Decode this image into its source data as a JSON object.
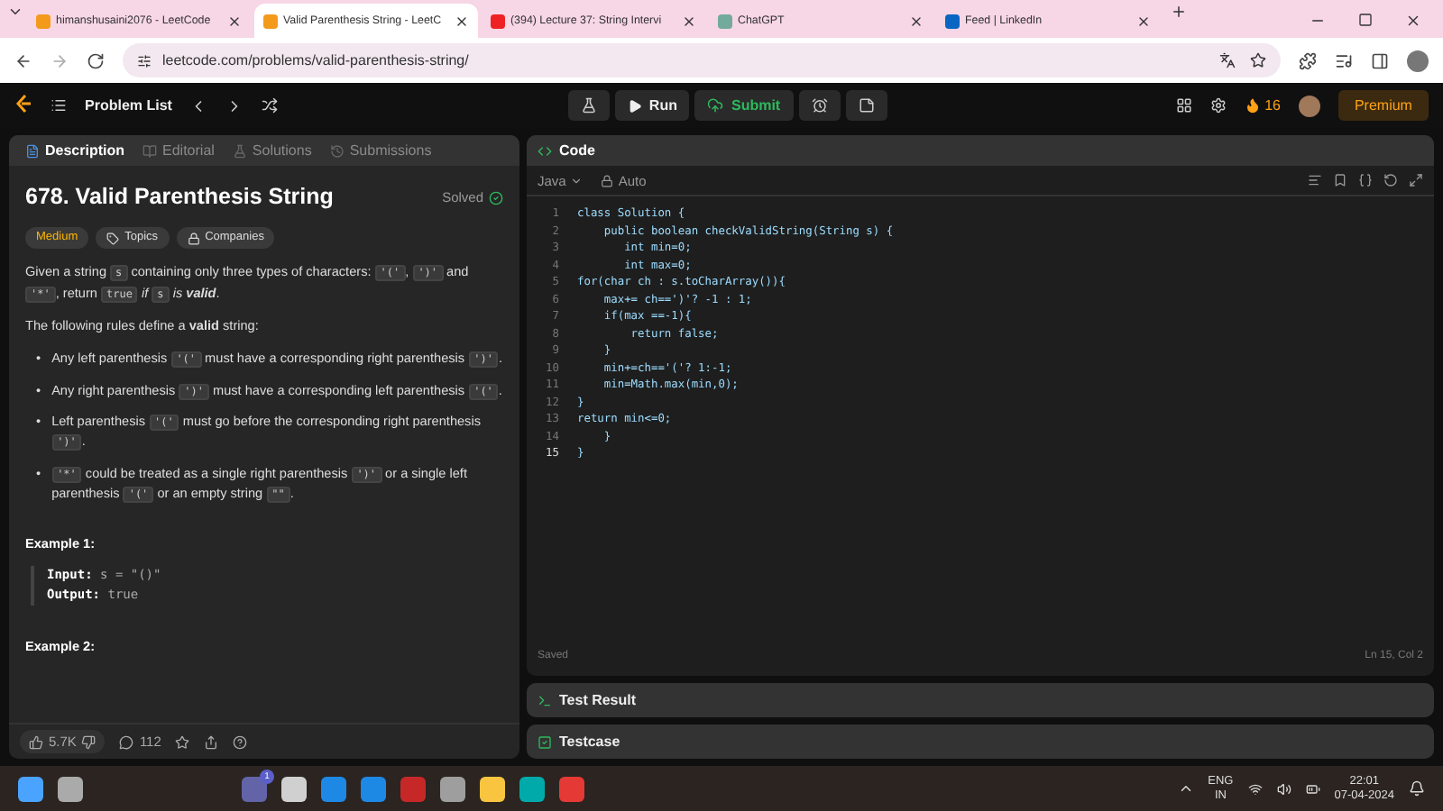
{
  "browser": {
    "tabs": [
      {
        "title": "himanshusaini2076 - LeetCode",
        "selected": false,
        "kind": "code-site"
      },
      {
        "title": "Valid Parenthesis String - LeetC",
        "selected": true,
        "kind": "code-site"
      },
      {
        "title": "(394) Lecture 37: String Intervi",
        "selected": false,
        "kind": "video"
      },
      {
        "title": "ChatGPT",
        "selected": false,
        "kind": "chat"
      },
      {
        "title": "Feed | LinkedIn",
        "selected": false,
        "kind": "network"
      }
    ],
    "url": "leetcode.com/problems/valid-parenthesis-string/"
  },
  "nav": {
    "problem_list": "Problem List",
    "run": "Run",
    "submit": "Submit",
    "streak": "16",
    "premium": "Premium"
  },
  "description": {
    "tabs": [
      {
        "label": "Description",
        "selected": true
      },
      {
        "label": "Editorial",
        "selected": false
      },
      {
        "label": "Solutions",
        "selected": false
      },
      {
        "label": "Submissions",
        "selected": false
      }
    ],
    "title": "678. Valid Parenthesis String",
    "status": "Solved",
    "tags": [
      {
        "label": "Medium",
        "kind": "difficulty"
      },
      {
        "label": "Topics",
        "kind": "topics"
      },
      {
        "label": "Companies",
        "kind": "companies"
      }
    ],
    "intro": [
      {
        "kind": "text",
        "text": "Given a string "
      },
      {
        "kind": "code",
        "text": "s"
      },
      {
        "kind": "text",
        "text": " containing only three types of characters: "
      },
      {
        "kind": "code",
        "text": "'('"
      },
      {
        "kind": "text",
        "text": ", "
      },
      {
        "kind": "code",
        "text": "')'"
      },
      {
        "kind": "text",
        "text": " and "
      },
      {
        "kind": "code",
        "text": "'*'"
      },
      {
        "kind": "text",
        "text": ", return "
      },
      {
        "kind": "code",
        "text": "true"
      },
      {
        "kind": "text",
        "text": " *if* "
      },
      {
        "kind": "code",
        "text": "s"
      },
      {
        "kind": "text",
        "text": " *is* "
      },
      {
        "kind": "emphasis",
        "text": "valid"
      },
      {
        "kind": "text",
        "text": "."
      }
    ],
    "rules_intro": "The following rules define a **valid** string:",
    "rules": [
      [
        {
          "kind": "text",
          "text": "Any left parenthesis "
        },
        {
          "kind": "code",
          "text": "'('"
        },
        {
          "kind": "text",
          "text": " must have a corresponding right parenthesis "
        },
        {
          "kind": "code",
          "text": "')'"
        },
        {
          "kind": "text",
          "text": "."
        }
      ],
      [
        {
          "kind": "text",
          "text": "Any right parenthesis "
        },
        {
          "kind": "code",
          "text": "')'"
        },
        {
          "kind": "text",
          "text": " must have a corresponding left parenthesis "
        },
        {
          "kind": "code",
          "text": "'('"
        },
        {
          "kind": "text",
          "text": "."
        }
      ],
      [
        {
          "kind": "text",
          "text": "Left parenthesis "
        },
        {
          "kind": "code",
          "text": "'('"
        },
        {
          "kind": "text",
          "text": " must go before the corresponding right parenthesis "
        },
        {
          "kind": "code",
          "text": "')'"
        },
        {
          "kind": "text",
          "text": "."
        }
      ],
      [
        {
          "kind": "code",
          "text": "'*'"
        },
        {
          "kind": "text",
          "text": " could be treated as a single right parenthesis "
        },
        {
          "kind": "code",
          "text": "')'"
        },
        {
          "kind": "text",
          "text": " or a single left parenthesis "
        },
        {
          "kind": "code",
          "text": "'('"
        },
        {
          "kind": "text",
          "text": " or an empty string "
        },
        {
          "kind": "code",
          "text": "\"\""
        },
        {
          "kind": "text",
          "text": "."
        }
      ]
    ],
    "examples": [
      {
        "heading": "Example 1:",
        "lines": [
          {
            "label": "Input:",
            "value": "s = \"()\""
          },
          {
            "label": "Output:",
            "value": "true"
          }
        ]
      },
      {
        "heading": "Example 2:"
      }
    ],
    "bullet": "•",
    "likes": "5.7K",
    "comments": "112"
  },
  "editor": {
    "title": "Code",
    "language": "Java",
    "mode": "Auto",
    "lines": [
      {
        "n": "1",
        "text": "class Solution {"
      },
      {
        "n": "2",
        "text": "    public boolean checkValidString(String s) {"
      },
      {
        "n": "3",
        "text": "       int min=0;"
      },
      {
        "n": "4",
        "text": "       int max=0;"
      },
      {
        "n": "5",
        "text": "for(char ch : s.toCharArray()){"
      },
      {
        "n": "6",
        "text": "    max+= ch==')'? -1 : 1;"
      },
      {
        "n": "7",
        "text": "    if(max ==-1){"
      },
      {
        "n": "8",
        "text": "        return false;"
      },
      {
        "n": "9",
        "text": "    }"
      },
      {
        "n": "10",
        "text": "    min+=ch=='('? 1:-1;"
      },
      {
        "n": "11",
        "text": "    min=Math.max(min,0);"
      },
      {
        "n": "12",
        "text": "}"
      },
      {
        "n": "13",
        "text": "return min<=0;"
      },
      {
        "n": "14",
        "text": "    }"
      },
      {
        "n": "15",
        "text": "}"
      }
    ],
    "saved": "Saved",
    "cursor": "Ln 15, Col 2"
  },
  "panels": [
    {
      "title": "Test Result",
      "kind": "result"
    },
    {
      "title": "Testcase",
      "kind": "testcase"
    }
  ],
  "taskbar": {
    "badge": "1",
    "lang": "ENG",
    "region": "IN",
    "time": "22:01",
    "date": "07-04-2024"
  }
}
